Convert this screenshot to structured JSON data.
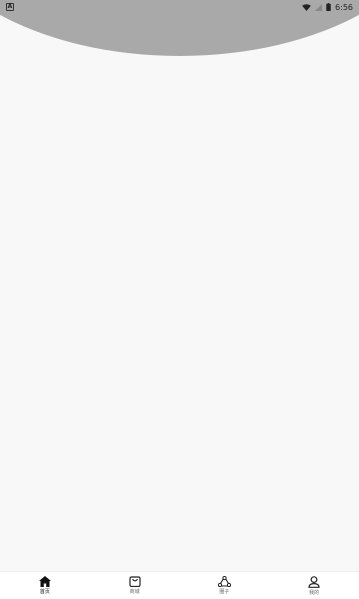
{
  "status_bar": {
    "left_badge": "A",
    "time": "6:56",
    "icons": [
      "wifi-icon",
      "signal-icon",
      "battery-icon"
    ]
  },
  "colors": {
    "header": "#a9a9a9",
    "background": "#f8f8f8",
    "tab_active": "#111111",
    "tab_inactive": "#666666"
  },
  "tabbar": {
    "items": [
      {
        "label": "首页",
        "icon": "home-icon",
        "active": true
      },
      {
        "label": "商城",
        "icon": "shop-bag-icon",
        "active": false
      },
      {
        "label": "圈子",
        "icon": "circle-group-icon",
        "active": false
      },
      {
        "label": "我的",
        "icon": "person-icon",
        "active": false
      }
    ]
  }
}
